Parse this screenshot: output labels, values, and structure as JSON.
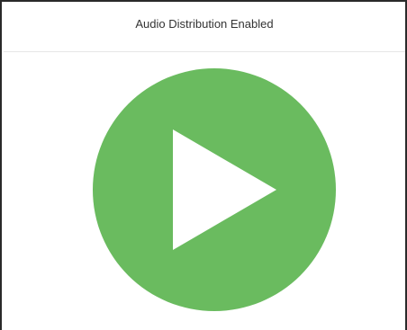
{
  "header": {
    "status_text": "Audio Distribution Enabled"
  },
  "play_button": {
    "icon": "play-icon",
    "color": "#6abb5f",
    "icon_color": "#ffffff"
  }
}
